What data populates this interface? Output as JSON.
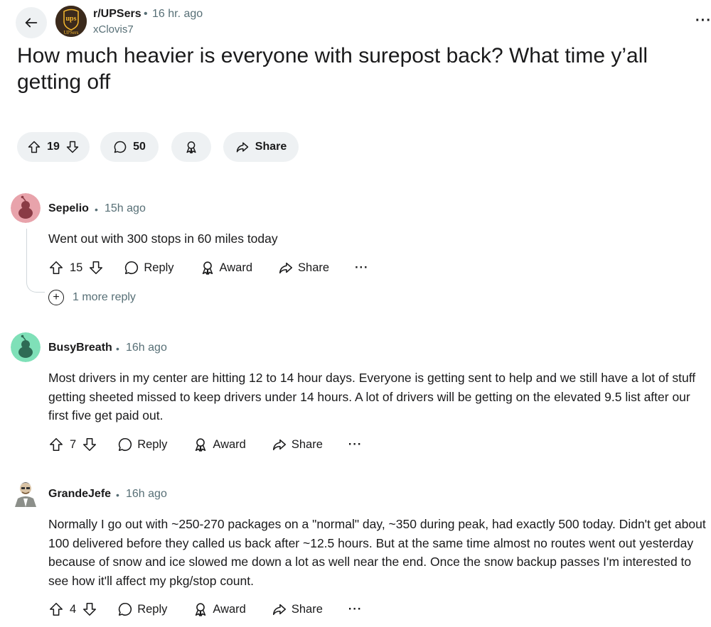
{
  "header": {
    "subreddit": "r/UPSers",
    "time": "16 hr. ago",
    "author": "xClovis7",
    "more": "···"
  },
  "post": {
    "title": "How much heavier is everyone with surepost back? What time y’all getting off",
    "votes": "19",
    "comments": "50",
    "share_label": "Share"
  },
  "comments": [
    {
      "author": "Sepelio",
      "time": "15h ago",
      "body": "Went out with 300 stops in 60 miles today",
      "votes": "15",
      "reply": "Reply",
      "award": "Award",
      "share": "Share",
      "more_replies": "1 more reply",
      "avatar_color": "#e8a3ab"
    },
    {
      "author": "BusyBreath",
      "time": "16h ago",
      "body": "Most drivers in my center are hitting 12 to 14 hour days. Everyone is getting sent to help and we still have a lot of stuff getting sheeted missed to keep drivers under 14 hours. A lot of drivers will be getting on the elevated 9.5 list after our first five get paid out.",
      "votes": "7",
      "reply": "Reply",
      "award": "Award",
      "share": "Share",
      "avatar_color": "#7fe0b8"
    },
    {
      "author": "GrandeJefe",
      "time": "16h ago",
      "body": "Normally I go out with ~250-270 packages on a \"normal\" day, ~350 during peak, had exactly 500 today. Didn't get about 100 delivered before they called us back after ~12.5 hours. But at the same time almost no routes went out yesterday because of snow and ice slowed me down a lot as well near the end. Once the snow backup passes I'm interested to see how it'll affect my pkg/stop count.",
      "votes": "4",
      "reply": "Reply",
      "award": "Award",
      "share": "Share"
    }
  ],
  "colors": {
    "pill_bg": "#eef1f3",
    "meta_text": "#576f76",
    "ups_brown": "#3b2a1c",
    "ups_gold": "#f5b82e"
  }
}
